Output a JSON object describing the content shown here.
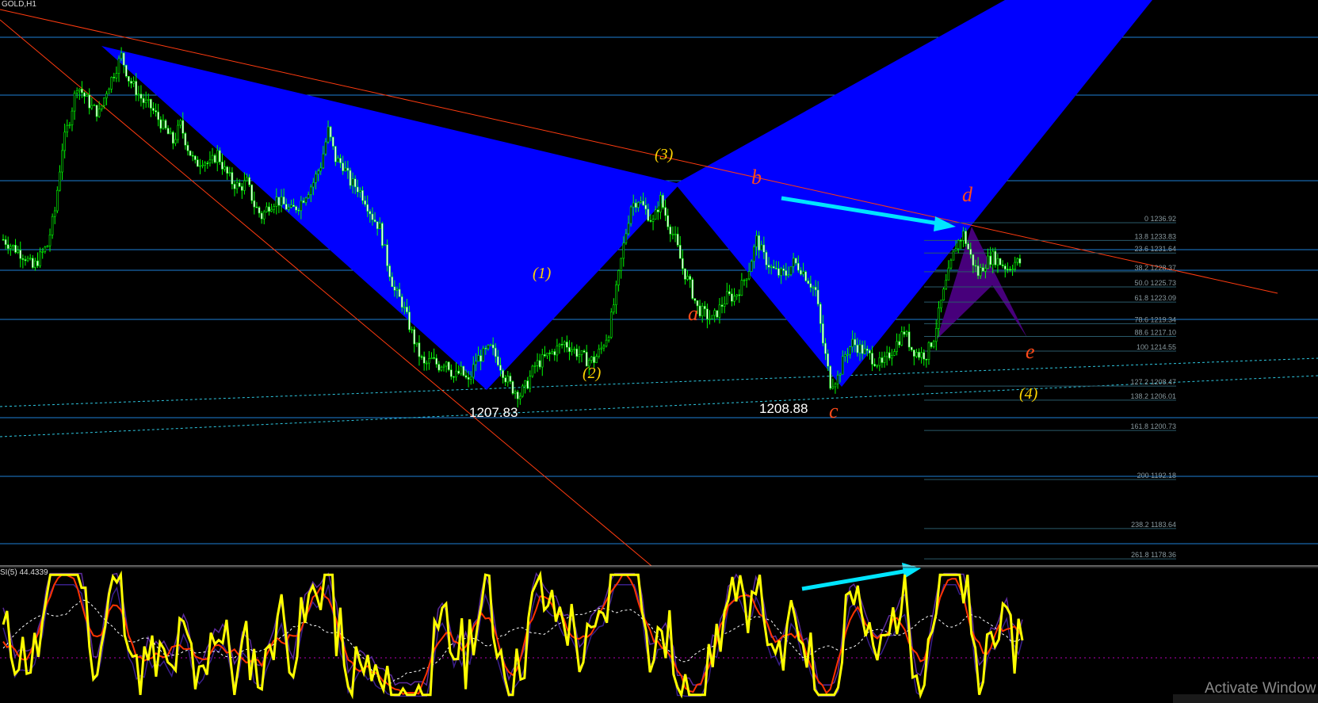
{
  "symbol_label": "GOLD,H1",
  "rsi_label": "SI(5) 44.4339",
  "watermark": "Activate Window",
  "colors": {
    "background": "#000000",
    "bull_candle": "#00ff00",
    "pattern_fill": "#0000ff",
    "small_pattern_fill": "#4b0082",
    "trendline": "#ff3b0f",
    "hline": "#1e7fd6",
    "fib_line": "#2a5a6a",
    "cyan_arrow": "#00e5ff",
    "wave_label_yellow": "#ffd400",
    "wave_label_red": "#ff4a1a",
    "rsi_main": "#ffff00",
    "rsi_signal": "#ff3300",
    "rsi_band": "#5b2a9a",
    "rsi_dash": "#ffffff",
    "rsi_level": "#ff00ff"
  },
  "chart_data": {
    "type": "candlestick",
    "symbol": "GOLD",
    "timeframe": "H1",
    "price_labels": [
      "1207.83",
      "1208.88"
    ],
    "elliott_wave_labels": [
      "(1)",
      "(2)",
      "(3)",
      "(4)"
    ],
    "abcde_labels": [
      "a",
      "b",
      "c",
      "d",
      "e"
    ],
    "fibonacci_levels": [
      {
        "level": "0",
        "price": "1236.92"
      },
      {
        "level": "13.8",
        "price": "1233.83"
      },
      {
        "level": "23.6",
        "price": "1231.64"
      },
      {
        "level": "38.2",
        "price": "1228.37"
      },
      {
        "level": "50.0",
        "price": "1225.73"
      },
      {
        "level": "61.8",
        "price": "1223.09"
      },
      {
        "level": "78.6",
        "price": "1219.34"
      },
      {
        "level": "88.6",
        "price": "1217.10"
      },
      {
        "level": "100",
        "price": "1214.55"
      },
      {
        "level": "127.2",
        "price": "1208.47"
      },
      {
        "level": "138.2",
        "price": "1206.01"
      },
      {
        "level": "161.8",
        "price": "1200.73"
      },
      {
        "level": "200",
        "price": "1192.18"
      },
      {
        "level": "238.2",
        "price": "1183.64"
      },
      {
        "level": "261.8",
        "price": "1178.36"
      }
    ],
    "price_path": [
      1234,
      1233,
      1232,
      1231,
      1229,
      1231,
      1233,
      1239,
      1250,
      1255,
      1261,
      1259,
      1257,
      1256,
      1260,
      1263,
      1266,
      1262,
      1260,
      1258,
      1257,
      1255,
      1253,
      1251,
      1254,
      1250,
      1247,
      1248,
      1247,
      1249,
      1246,
      1244,
      1243,
      1244,
      1240,
      1238,
      1240,
      1241,
      1240,
      1239,
      1240,
      1242,
      1244,
      1247,
      1253,
      1248,
      1247,
      1244,
      1243,
      1241,
      1238,
      1236,
      1230,
      1225,
      1223,
      1219,
      1215,
      1212,
      1213,
      1212,
      1213,
      1210,
      1211,
      1209,
      1213,
      1214,
      1215,
      1213,
      1210,
      1208,
      1207,
      1209,
      1212,
      1213,
      1214,
      1215,
      1216,
      1215,
      1214,
      1213,
      1213,
      1215,
      1218,
      1225,
      1233,
      1240,
      1241,
      1239,
      1237,
      1241,
      1237,
      1234,
      1229,
      1226,
      1222,
      1221,
      1220,
      1222,
      1224,
      1224,
      1226,
      1229,
      1234,
      1231,
      1229,
      1228,
      1228,
      1230,
      1229,
      1227,
      1225,
      1216,
      1209,
      1210,
      1214,
      1216,
      1215,
      1214,
      1213,
      1212,
      1214,
      1216,
      1218,
      1215,
      1214,
      1214,
      1217,
      1223,
      1228,
      1233,
      1235,
      1231,
      1228,
      1230,
      1231,
      1230,
      1229,
      1230,
      1230
    ],
    "rsi_value": "44.4339"
  }
}
